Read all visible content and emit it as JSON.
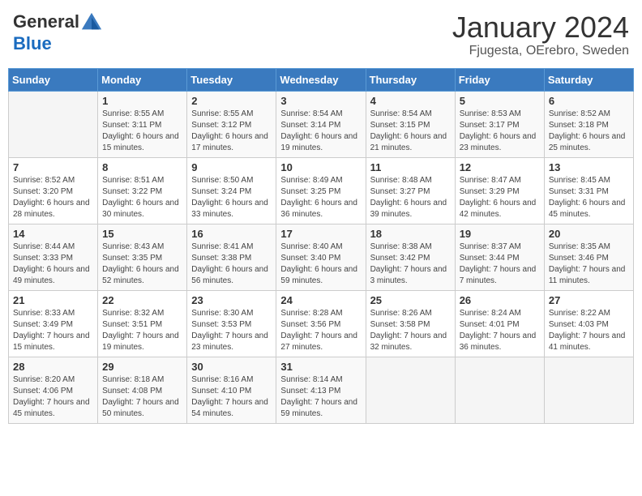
{
  "header": {
    "logo_general": "General",
    "logo_blue": "Blue",
    "month_title": "January 2024",
    "subtitle": "Fjugesta, OErebro, Sweden"
  },
  "days_of_week": [
    "Sunday",
    "Monday",
    "Tuesday",
    "Wednesday",
    "Thursday",
    "Friday",
    "Saturday"
  ],
  "weeks": [
    [
      {
        "num": "",
        "sunrise": "",
        "sunset": "",
        "daylight": ""
      },
      {
        "num": "1",
        "sunrise": "Sunrise: 8:55 AM",
        "sunset": "Sunset: 3:11 PM",
        "daylight": "Daylight: 6 hours and 15 minutes."
      },
      {
        "num": "2",
        "sunrise": "Sunrise: 8:55 AM",
        "sunset": "Sunset: 3:12 PM",
        "daylight": "Daylight: 6 hours and 17 minutes."
      },
      {
        "num": "3",
        "sunrise": "Sunrise: 8:54 AM",
        "sunset": "Sunset: 3:14 PM",
        "daylight": "Daylight: 6 hours and 19 minutes."
      },
      {
        "num": "4",
        "sunrise": "Sunrise: 8:54 AM",
        "sunset": "Sunset: 3:15 PM",
        "daylight": "Daylight: 6 hours and 21 minutes."
      },
      {
        "num": "5",
        "sunrise": "Sunrise: 8:53 AM",
        "sunset": "Sunset: 3:17 PM",
        "daylight": "Daylight: 6 hours and 23 minutes."
      },
      {
        "num": "6",
        "sunrise": "Sunrise: 8:52 AM",
        "sunset": "Sunset: 3:18 PM",
        "daylight": "Daylight: 6 hours and 25 minutes."
      }
    ],
    [
      {
        "num": "7",
        "sunrise": "Sunrise: 8:52 AM",
        "sunset": "Sunset: 3:20 PM",
        "daylight": "Daylight: 6 hours and 28 minutes."
      },
      {
        "num": "8",
        "sunrise": "Sunrise: 8:51 AM",
        "sunset": "Sunset: 3:22 PM",
        "daylight": "Daylight: 6 hours and 30 minutes."
      },
      {
        "num": "9",
        "sunrise": "Sunrise: 8:50 AM",
        "sunset": "Sunset: 3:24 PM",
        "daylight": "Daylight: 6 hours and 33 minutes."
      },
      {
        "num": "10",
        "sunrise": "Sunrise: 8:49 AM",
        "sunset": "Sunset: 3:25 PM",
        "daylight": "Daylight: 6 hours and 36 minutes."
      },
      {
        "num": "11",
        "sunrise": "Sunrise: 8:48 AM",
        "sunset": "Sunset: 3:27 PM",
        "daylight": "Daylight: 6 hours and 39 minutes."
      },
      {
        "num": "12",
        "sunrise": "Sunrise: 8:47 AM",
        "sunset": "Sunset: 3:29 PM",
        "daylight": "Daylight: 6 hours and 42 minutes."
      },
      {
        "num": "13",
        "sunrise": "Sunrise: 8:45 AM",
        "sunset": "Sunset: 3:31 PM",
        "daylight": "Daylight: 6 hours and 45 minutes."
      }
    ],
    [
      {
        "num": "14",
        "sunrise": "Sunrise: 8:44 AM",
        "sunset": "Sunset: 3:33 PM",
        "daylight": "Daylight: 6 hours and 49 minutes."
      },
      {
        "num": "15",
        "sunrise": "Sunrise: 8:43 AM",
        "sunset": "Sunset: 3:35 PM",
        "daylight": "Daylight: 6 hours and 52 minutes."
      },
      {
        "num": "16",
        "sunrise": "Sunrise: 8:41 AM",
        "sunset": "Sunset: 3:38 PM",
        "daylight": "Daylight: 6 hours and 56 minutes."
      },
      {
        "num": "17",
        "sunrise": "Sunrise: 8:40 AM",
        "sunset": "Sunset: 3:40 PM",
        "daylight": "Daylight: 6 hours and 59 minutes."
      },
      {
        "num": "18",
        "sunrise": "Sunrise: 8:38 AM",
        "sunset": "Sunset: 3:42 PM",
        "daylight": "Daylight: 7 hours and 3 minutes."
      },
      {
        "num": "19",
        "sunrise": "Sunrise: 8:37 AM",
        "sunset": "Sunset: 3:44 PM",
        "daylight": "Daylight: 7 hours and 7 minutes."
      },
      {
        "num": "20",
        "sunrise": "Sunrise: 8:35 AM",
        "sunset": "Sunset: 3:46 PM",
        "daylight": "Daylight: 7 hours and 11 minutes."
      }
    ],
    [
      {
        "num": "21",
        "sunrise": "Sunrise: 8:33 AM",
        "sunset": "Sunset: 3:49 PM",
        "daylight": "Daylight: 7 hours and 15 minutes."
      },
      {
        "num": "22",
        "sunrise": "Sunrise: 8:32 AM",
        "sunset": "Sunset: 3:51 PM",
        "daylight": "Daylight: 7 hours and 19 minutes."
      },
      {
        "num": "23",
        "sunrise": "Sunrise: 8:30 AM",
        "sunset": "Sunset: 3:53 PM",
        "daylight": "Daylight: 7 hours and 23 minutes."
      },
      {
        "num": "24",
        "sunrise": "Sunrise: 8:28 AM",
        "sunset": "Sunset: 3:56 PM",
        "daylight": "Daylight: 7 hours and 27 minutes."
      },
      {
        "num": "25",
        "sunrise": "Sunrise: 8:26 AM",
        "sunset": "Sunset: 3:58 PM",
        "daylight": "Daylight: 7 hours and 32 minutes."
      },
      {
        "num": "26",
        "sunrise": "Sunrise: 8:24 AM",
        "sunset": "Sunset: 4:01 PM",
        "daylight": "Daylight: 7 hours and 36 minutes."
      },
      {
        "num": "27",
        "sunrise": "Sunrise: 8:22 AM",
        "sunset": "Sunset: 4:03 PM",
        "daylight": "Daylight: 7 hours and 41 minutes."
      }
    ],
    [
      {
        "num": "28",
        "sunrise": "Sunrise: 8:20 AM",
        "sunset": "Sunset: 4:06 PM",
        "daylight": "Daylight: 7 hours and 45 minutes."
      },
      {
        "num": "29",
        "sunrise": "Sunrise: 8:18 AM",
        "sunset": "Sunset: 4:08 PM",
        "daylight": "Daylight: 7 hours and 50 minutes."
      },
      {
        "num": "30",
        "sunrise": "Sunrise: 8:16 AM",
        "sunset": "Sunset: 4:10 PM",
        "daylight": "Daylight: 7 hours and 54 minutes."
      },
      {
        "num": "31",
        "sunrise": "Sunrise: 8:14 AM",
        "sunset": "Sunset: 4:13 PM",
        "daylight": "Daylight: 7 hours and 59 minutes."
      },
      {
        "num": "",
        "sunrise": "",
        "sunset": "",
        "daylight": ""
      },
      {
        "num": "",
        "sunrise": "",
        "sunset": "",
        "daylight": ""
      },
      {
        "num": "",
        "sunrise": "",
        "sunset": "",
        "daylight": ""
      }
    ]
  ]
}
